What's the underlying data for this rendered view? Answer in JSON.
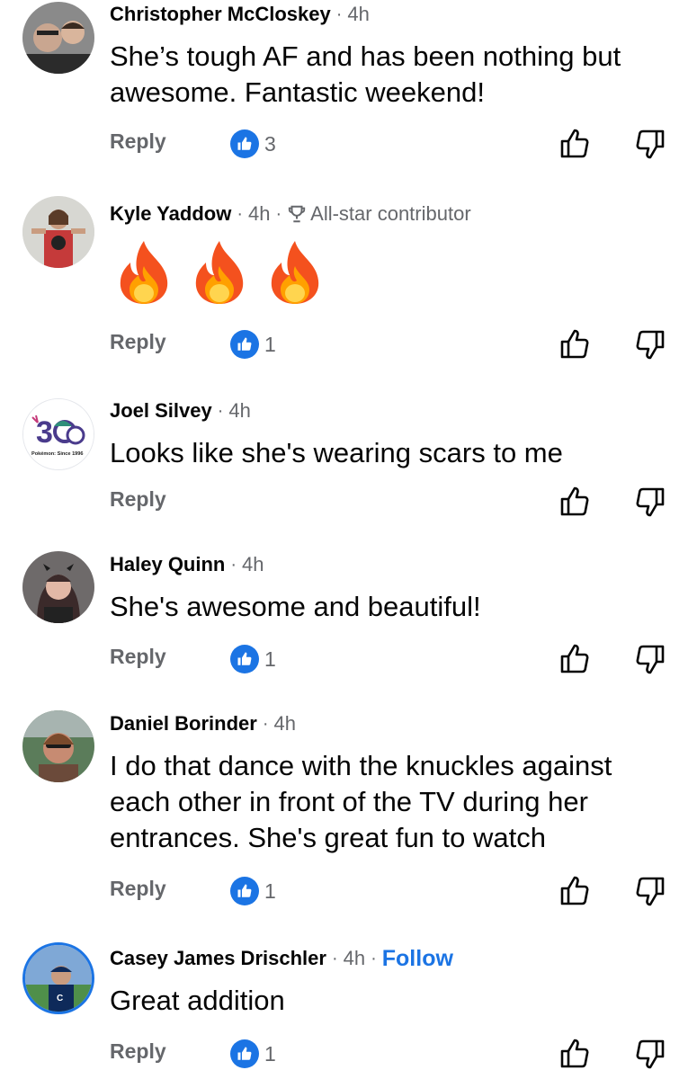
{
  "comments": [
    {
      "name": "Christopher McCloskey",
      "time": "4h",
      "text_lines": [
        "She’s tough AF and has been nothing but",
        "awesome. Fantastic weekend!"
      ],
      "reply_label": "Reply",
      "reaction_count": "3"
    },
    {
      "name": "Kyle Yaddow",
      "time": "4h",
      "badge": "All-star contributor",
      "emoji": [
        "fire-emoji",
        "fire-emoji",
        "fire-emoji"
      ],
      "reply_label": "Reply",
      "reaction_count": "1"
    },
    {
      "name": "Joel Silvey",
      "time": "4h",
      "text_lines": [
        "Looks like she's wearing scars to me"
      ],
      "reply_label": "Reply",
      "avatar_caption": "Pokémon: Since 1996"
    },
    {
      "name": "Haley Quinn",
      "time": "4h",
      "text_lines": [
        "She's awesome and beautiful!"
      ],
      "reply_label": "Reply",
      "reaction_count": "1"
    },
    {
      "name": "Daniel Borinder",
      "time": "4h",
      "text_lines": [
        "I do that dance with the knuckles against",
        "each other in front of the TV during her",
        "entrances. She's great fun to watch"
      ],
      "reply_label": "Reply",
      "reaction_count": "1"
    },
    {
      "name": "Casey James Drischler",
      "time": "4h",
      "follow_label": "Follow",
      "text_lines": [
        "Great addition"
      ],
      "reply_label": "Reply",
      "reaction_count": "1"
    }
  ],
  "separator": "·",
  "colors": {
    "accent": "#1b74e4",
    "secondary_text": "#65676b"
  },
  "icons": [
    "like-icon",
    "thumb-up-icon",
    "thumb-down-icon",
    "trophy-icon",
    "fire-emoji"
  ]
}
